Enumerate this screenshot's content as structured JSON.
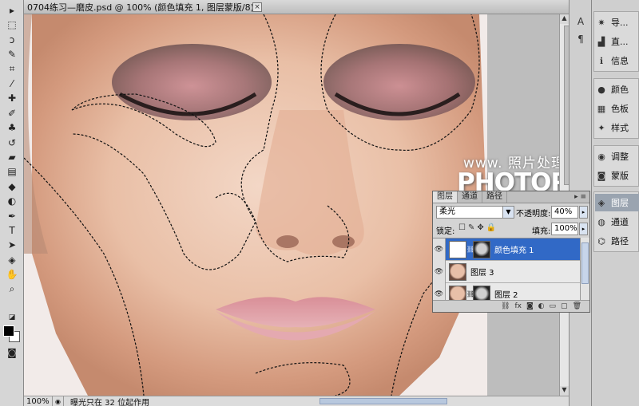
{
  "document": {
    "title": "0704练习—磨皮.psd @ 100% (颜色填充 1, 图层蒙版/8) *",
    "close_glyph": "×"
  },
  "status": {
    "zoom": "100%",
    "message": "曝光只在 32 位起作用"
  },
  "watermark": {
    "line1": "www. 照片处理网",
    "line2": "PHOTOPS.COM"
  },
  "toolbox": {
    "tools": [
      {
        "icon": "move-icon",
        "glyph": "▸"
      },
      {
        "icon": "marquee-icon",
        "glyph": "⬚"
      },
      {
        "icon": "lasso-icon",
        "glyph": "ↄ"
      },
      {
        "icon": "quick-select-icon",
        "glyph": "✎"
      },
      {
        "icon": "crop-icon",
        "glyph": "⌗"
      },
      {
        "icon": "eyedropper-icon",
        "glyph": "⁄"
      },
      {
        "icon": "healing-brush-icon",
        "glyph": "✚"
      },
      {
        "icon": "brush-icon",
        "glyph": "✐"
      },
      {
        "icon": "clone-stamp-icon",
        "glyph": "♣"
      },
      {
        "icon": "history-brush-icon",
        "glyph": "↺"
      },
      {
        "icon": "eraser-icon",
        "glyph": "▰"
      },
      {
        "icon": "gradient-icon",
        "glyph": "▤"
      },
      {
        "icon": "blur-icon",
        "glyph": "◆"
      },
      {
        "icon": "dodge-icon",
        "glyph": "◐"
      },
      {
        "icon": "pen-icon",
        "glyph": "✒"
      },
      {
        "icon": "type-icon",
        "glyph": "T"
      },
      {
        "icon": "path-select-icon",
        "glyph": "➤"
      },
      {
        "icon": "shape-icon",
        "glyph": "◈"
      },
      {
        "icon": "hand-icon",
        "glyph": "✋"
      },
      {
        "icon": "zoom-icon",
        "glyph": "⌕"
      }
    ],
    "default_colors_glyph": "◪",
    "quick_mask_glyph": "◙"
  },
  "dock": {
    "icons": [
      {
        "icon": "collapse-icon",
        "glyph": "A"
      },
      {
        "icon": "paragraph-icon",
        "glyph": "¶"
      }
    ]
  },
  "panels": {
    "group1": [
      {
        "icon": "navigator-icon",
        "glyph": "✷",
        "label": "导..."
      },
      {
        "icon": "histogram-icon",
        "glyph": "▟",
        "label": "直..."
      },
      {
        "icon": "info-icon",
        "glyph": "ℹ",
        "label": "信息"
      }
    ],
    "group2": [
      {
        "icon": "color-icon",
        "glyph": "●",
        "label": "颜色"
      },
      {
        "icon": "swatches-icon",
        "glyph": "▦",
        "label": "色板"
      },
      {
        "icon": "styles-icon",
        "glyph": "✦",
        "label": "样式"
      }
    ],
    "group3": [
      {
        "icon": "adjustments-icon",
        "glyph": "◉",
        "label": "调整"
      },
      {
        "icon": "masks-icon",
        "glyph": "◙",
        "label": "蒙版"
      }
    ],
    "group4": [
      {
        "icon": "layers-icon",
        "glyph": "◈",
        "label": "图层",
        "active": true
      },
      {
        "icon": "channels-icon",
        "glyph": "◍",
        "label": "通道"
      },
      {
        "icon": "paths-icon",
        "glyph": "⌬",
        "label": "路径"
      }
    ]
  },
  "layers_panel": {
    "tabs": [
      "图层",
      "通道",
      "路径"
    ],
    "menu_glyph": "▸ ≡",
    "blend_mode": "柔光",
    "opacity_label": "不透明度:",
    "opacity_value": "40%",
    "lock_label": "锁定:",
    "lock_icons": [
      "☐",
      "✎",
      "✥",
      "🔒"
    ],
    "fill_label": "填充:",
    "fill_value": "100%",
    "layers": [
      {
        "name": "颜色填充 1",
        "selected": true,
        "visible": true,
        "thumb": "white",
        "mask": true
      },
      {
        "name": "图层 3",
        "selected": false,
        "visible": true,
        "thumb": "face",
        "mask": false
      },
      {
        "name": "图层 2",
        "selected": false,
        "visible": true,
        "thumb": "face",
        "mask": true
      }
    ],
    "footer_icons": [
      "⛓",
      "fx",
      "◙",
      "◐",
      "▭",
      "▢",
      "🗑"
    ]
  }
}
